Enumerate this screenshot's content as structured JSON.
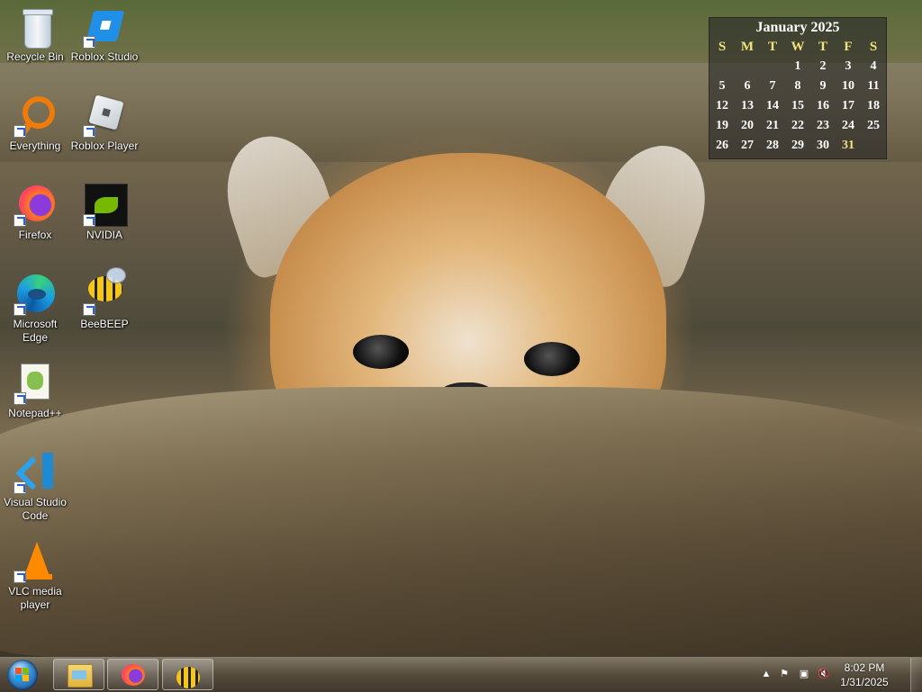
{
  "desktop": {
    "icons": [
      {
        "label": "Recycle Bin",
        "icon": "recycle-bin-icon"
      },
      {
        "label": "Roblox Studio",
        "icon": "roblox-studio-icon"
      },
      {
        "label": "Everything",
        "icon": "everything-icon"
      },
      {
        "label": "Roblox Player",
        "icon": "roblox-player-icon"
      },
      {
        "label": "Firefox",
        "icon": "firefox-icon"
      },
      {
        "label": "NVIDIA",
        "icon": "nvidia-icon"
      },
      {
        "label": "Microsoft Edge",
        "icon": "edge-icon"
      },
      {
        "label": "BeeBEEP",
        "icon": "beebeep-icon"
      },
      {
        "label": "Notepad++",
        "icon": "notepadpp-icon"
      },
      {
        "label": "Visual Studio Code",
        "icon": "vscode-icon"
      },
      {
        "label": "VLC media player",
        "icon": "vlc-icon"
      }
    ]
  },
  "calendar": {
    "title": "January 2025",
    "weekdays": [
      "S",
      "M",
      "T",
      "W",
      "T",
      "F",
      "S"
    ],
    "days": [
      "",
      "",
      "",
      "1",
      "2",
      "3",
      "4",
      "5",
      "6",
      "7",
      "8",
      "9",
      "10",
      "11",
      "12",
      "13",
      "14",
      "15",
      "16",
      "17",
      "18",
      "19",
      "20",
      "21",
      "22",
      "23",
      "24",
      "25",
      "26",
      "27",
      "28",
      "29",
      "30",
      "31",
      ""
    ],
    "today": "31",
    "today_color": "#f2e27a"
  },
  "taskbar": {
    "pinned": [
      {
        "icon": "file-explorer-icon"
      },
      {
        "icon": "firefox-icon"
      },
      {
        "icon": "beebeep-icon"
      }
    ],
    "tray": {
      "icons": [
        "show-hidden-icons-icon",
        "action-center-flag-icon",
        "network-icon",
        "volume-muted-icon"
      ]
    },
    "clock": {
      "time": "8:02 PM",
      "date": "1/31/2025"
    }
  }
}
